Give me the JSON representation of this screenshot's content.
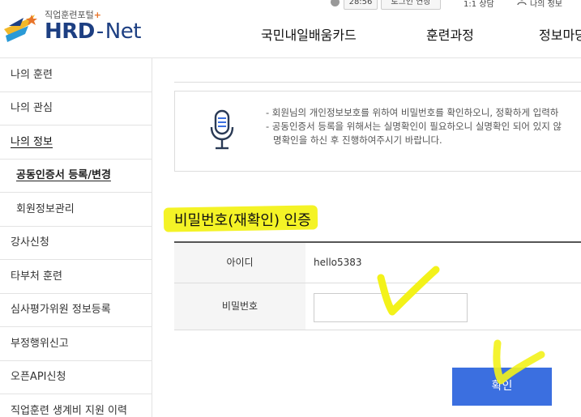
{
  "header": {
    "logo_sub": "직업훈련포털",
    "logo_plus": "+",
    "logo_hrd": "HRD",
    "logo_dash": "-",
    "logo_net": "Net",
    "time": "28:56",
    "extend_label": "로그인 연장",
    "consult_label": "1:1 상담",
    "myinfo_label": "나의 정보",
    "nav": [
      "국민내일배움카드",
      "훈련과정",
      "정보마당"
    ]
  },
  "sidebar": {
    "items": [
      {
        "label": "나의 훈련"
      },
      {
        "label": "나의 관심"
      },
      {
        "label": "나의 정보"
      },
      {
        "label": "공동인증서 등록/변경"
      },
      {
        "label": "회원정보관리"
      },
      {
        "label": "강사신청"
      },
      {
        "label": "타부처 훈련"
      },
      {
        "label": "심사평가위원 정보등록"
      },
      {
        "label": "부정행위신고"
      },
      {
        "label": "오픈API신청"
      },
      {
        "label": "직업훈련 생계비 지원 이력"
      }
    ]
  },
  "notice": {
    "line1": "- 회원님의 개인정보보호를 위하여 비밀번호를 확인하오니, 정확하게 입력하",
    "line2": "- 공동인증서 등록을 위해서는 실명확인이 필요하오니 실명확인 되어 있지 않",
    "line3": "명확인을 하신 후 진행하여주시기 바랍니다."
  },
  "section_title": "비밀번호(재확인) 인증",
  "form": {
    "id_label": "아이디",
    "id_value": "hello5383",
    "pw_label": "비밀번호",
    "pw_value": ""
  },
  "confirm_label": "확인",
  "colors": {
    "brand_blue": "#1d3f82",
    "button_blue": "#3b6fe0",
    "highlight": "#f3f21a"
  }
}
